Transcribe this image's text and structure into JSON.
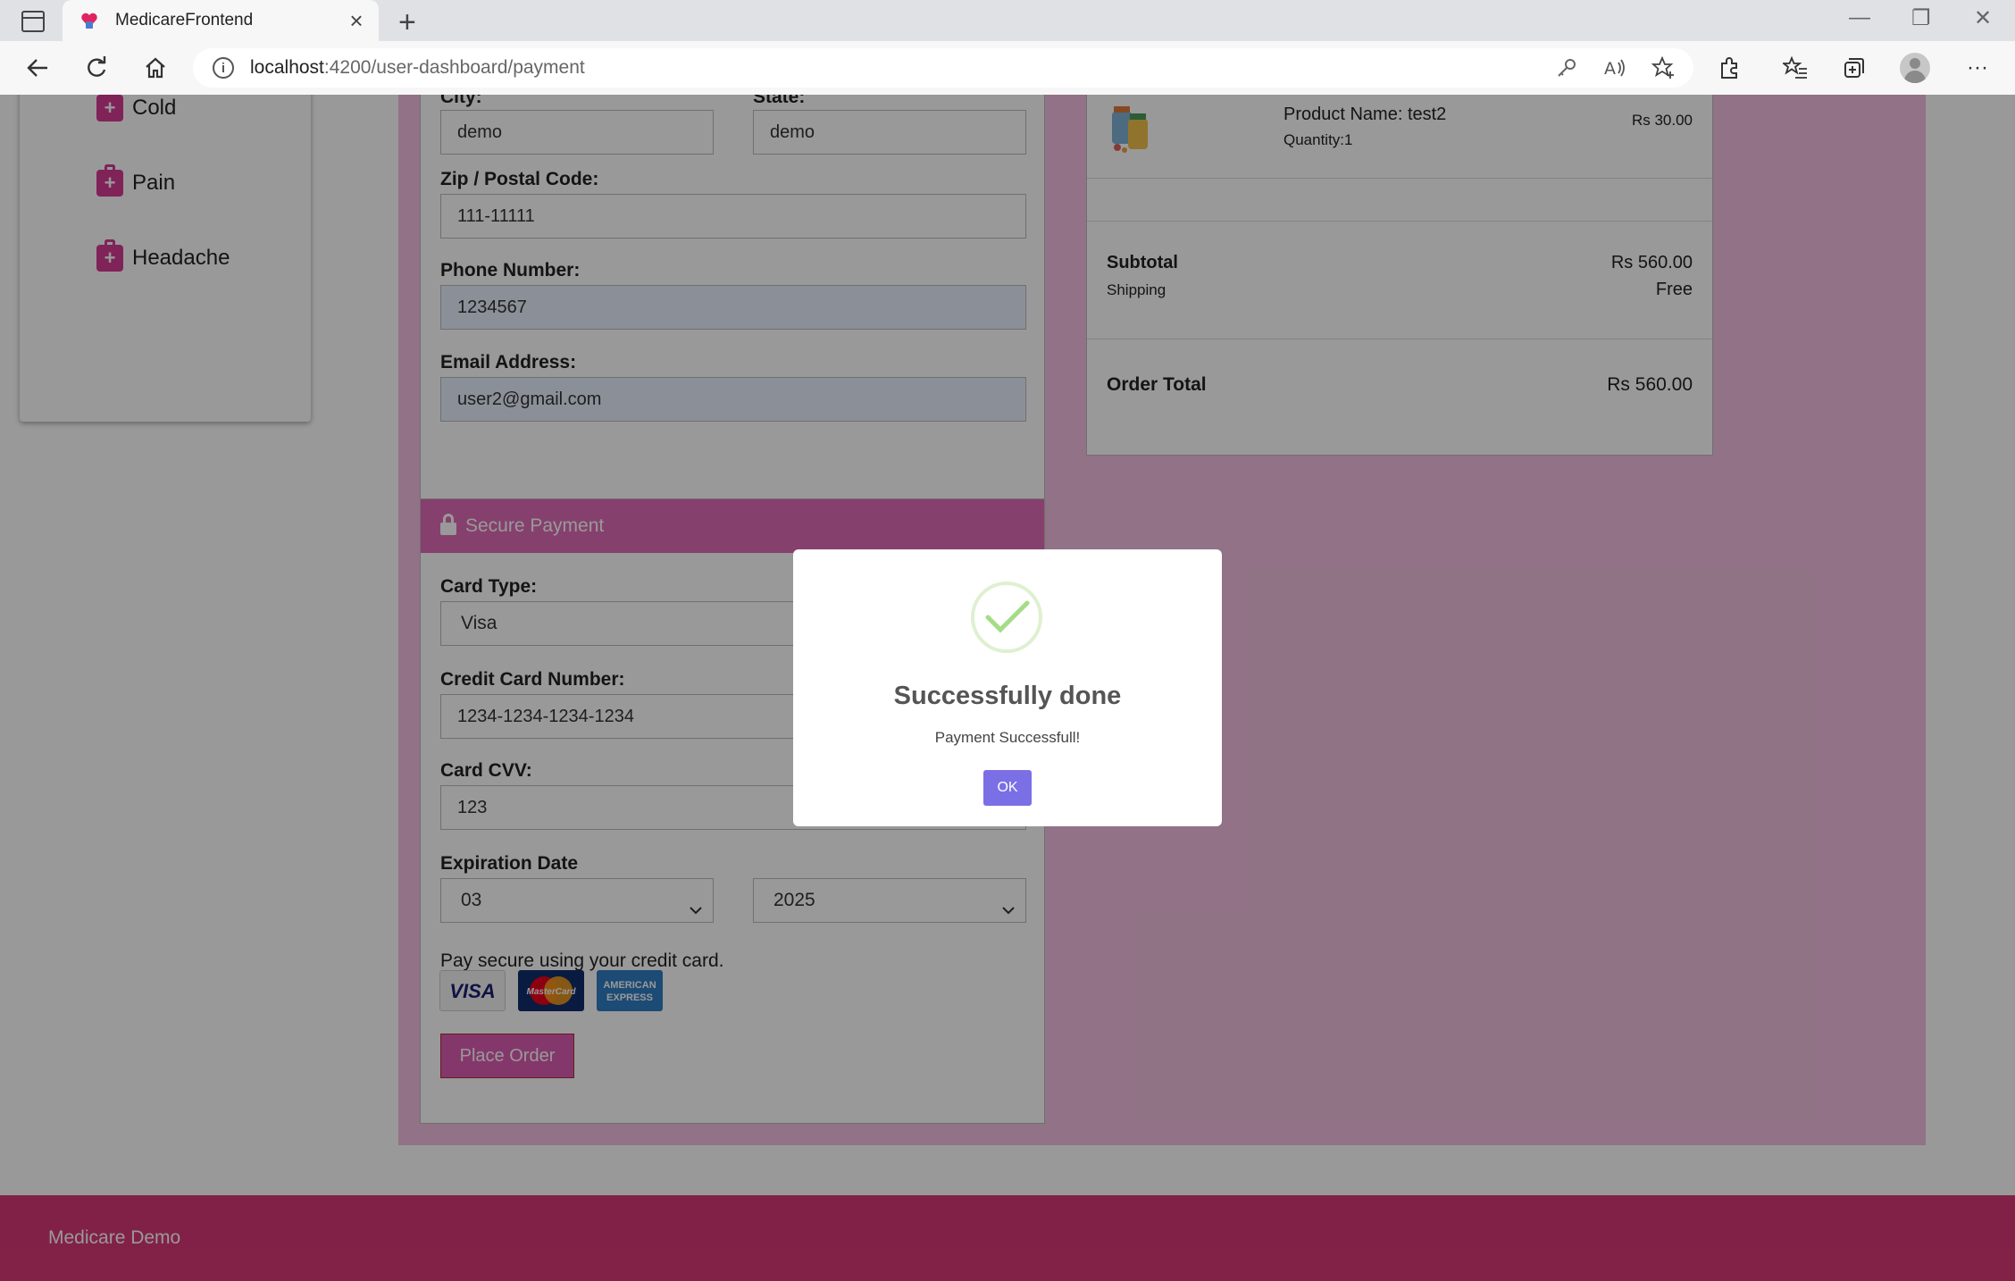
{
  "browser": {
    "tab_title": "MedicareFrontend",
    "new_tab_symbol": "+",
    "close_symbol": "×",
    "url_host": "localhost",
    "url_rest": ":4200/user-dashboard/payment",
    "window_controls": [
      "—",
      "❐",
      "✕"
    ],
    "more_symbol": "···"
  },
  "sidebar": {
    "items": [
      {
        "label": "Cold",
        "icon": "medical-kit-icon"
      },
      {
        "label": "Pain",
        "icon": "medical-kit-icon"
      },
      {
        "label": "Headache",
        "icon": "medical-kit-icon"
      }
    ]
  },
  "address_form": {
    "city_label": "City:",
    "city_value": "demo",
    "state_label": "State:",
    "state_value": "demo",
    "zip_label": "Zip / Postal Code:",
    "zip_value": "111-11111",
    "phone_label": "Phone Number:",
    "phone_value": "1234567",
    "email_label": "Email Address:",
    "email_value": "user2@gmail.com"
  },
  "payment": {
    "header": "Secure Payment",
    "card_type_label": "Card Type:",
    "card_type_value": "Visa",
    "card_number_label": "Credit Card Number:",
    "card_number_value": "1234-1234-1234-1234",
    "cvv_label": "Card CVV:",
    "cvv_value": "123",
    "expiration_label": "Expiration Date",
    "exp_month": "03",
    "exp_year": "2025",
    "pay_secure_text": "Pay secure using your credit card.",
    "card_logos": [
      "VISA",
      "MasterCard",
      "AMERICAN EXPRESS"
    ],
    "place_order_label": "Place Order"
  },
  "summary": {
    "product_name": "Product Name: test2",
    "quantity": "Quantity:1",
    "product_price": "Rs 30.00",
    "subtotal_label": "Subtotal",
    "subtotal_value": "Rs 560.00",
    "shipping_label": "Shipping",
    "shipping_value": "Free",
    "order_total_label": "Order Total",
    "order_total_value": "Rs 560.00"
  },
  "footer": {
    "text": "Medicare Demo"
  },
  "modal": {
    "title": "Successfully done",
    "message": "Payment Successfull!",
    "ok_label": "OK"
  },
  "colors": {
    "brand_pink": "#d63b94",
    "page_background": "#f2bfe0",
    "footer": "#d93877",
    "ok_button": "#7b6fe6",
    "success_green": "#a5dc86"
  }
}
